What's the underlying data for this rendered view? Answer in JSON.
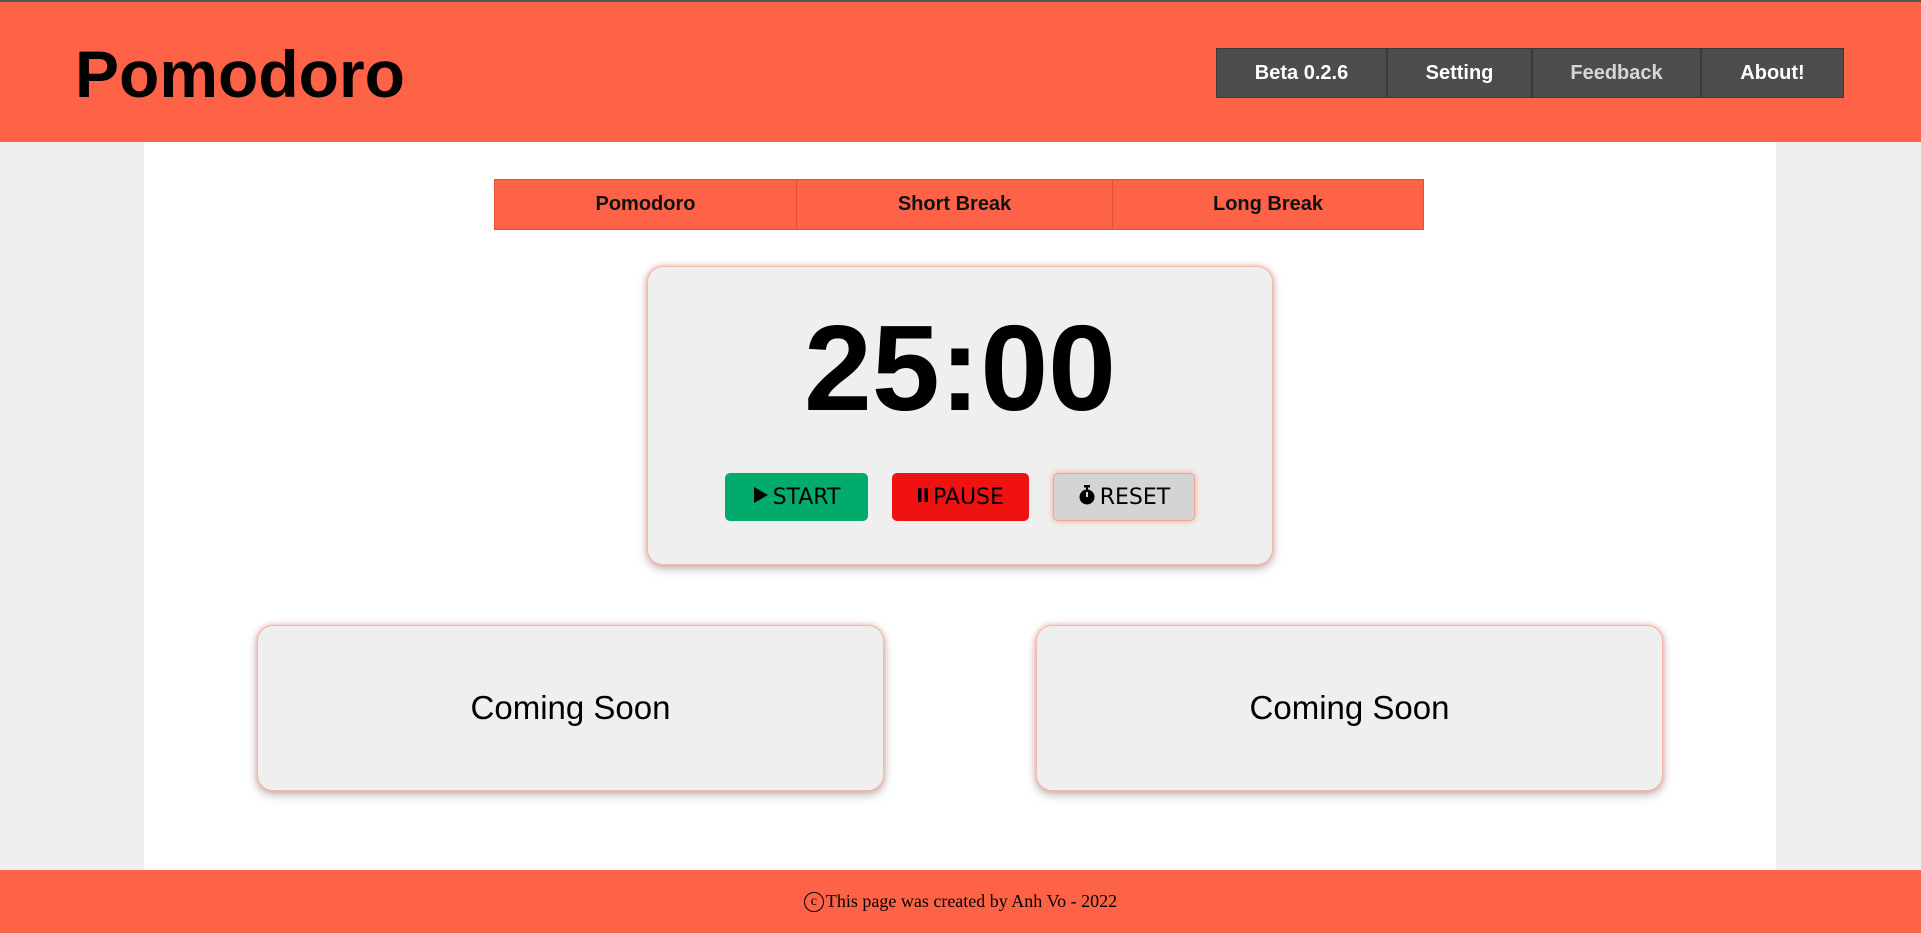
{
  "header": {
    "title": "Pomodoro",
    "nav": [
      {
        "label": "Beta 0.2.6"
      },
      {
        "label": "Setting"
      },
      {
        "label": "Feedback"
      },
      {
        "label": "About!"
      }
    ]
  },
  "modes": [
    {
      "label": "Pomodoro"
    },
    {
      "label": "Short Break"
    },
    {
      "label": "Long Break"
    }
  ],
  "timer": {
    "display": "25:00",
    "start_label": "START",
    "pause_label": "PAUSE",
    "reset_label": "RESET",
    "start_icon": "play-icon",
    "pause_icon": "pause-icon",
    "reset_icon": "stopwatch-icon"
  },
  "cards": [
    {
      "label": "Coming Soon"
    },
    {
      "label": "Coming Soon"
    }
  ],
  "footer": {
    "text": "This page was created by Anh Vo - 2022",
    "icon": "copyright-icon"
  },
  "colors": {
    "brand": "#ff6347",
    "nav_bg": "#4d4d4d",
    "start": "#00ab6b",
    "pause": "#f01111",
    "reset": "#d4d4d4",
    "panel": "#efefef"
  }
}
